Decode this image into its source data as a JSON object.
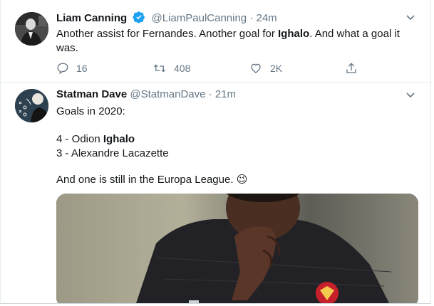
{
  "tweets": [
    {
      "author": {
        "name": "Liam Canning",
        "handle": "@LiamPaulCanning",
        "verified": true
      },
      "time": "24m",
      "text": {
        "p1": "Another assist for Fernandes. Another goal for ",
        "bold": "Ighalo",
        "p2": ". And what a goal it was."
      },
      "stats": {
        "replies": "16",
        "retweets": "408",
        "likes": "2K"
      }
    },
    {
      "author": {
        "name": "Statman Dave",
        "handle": "@StatmanDave",
        "verified": false
      },
      "time": "21m",
      "lines": {
        "intro": "Goals in 2020:",
        "row1_prefix": "4 - Odion ",
        "row1_bold": "Ighalo",
        "row2": "3 - Alexandre Lacazette",
        "closing": "And one is still in the Europa League.",
        "emoji": "😉"
      }
    }
  ],
  "icons": {
    "verified": "verified-badge-icon",
    "more": "chevron-down-icon",
    "reply": "reply-icon",
    "retweet": "retweet-icon",
    "like": "heart-icon",
    "share": "share-icon"
  },
  "colors": {
    "verified": "#1da1f2",
    "secondary_text": "#657786",
    "divider": "#e6ecf0"
  }
}
